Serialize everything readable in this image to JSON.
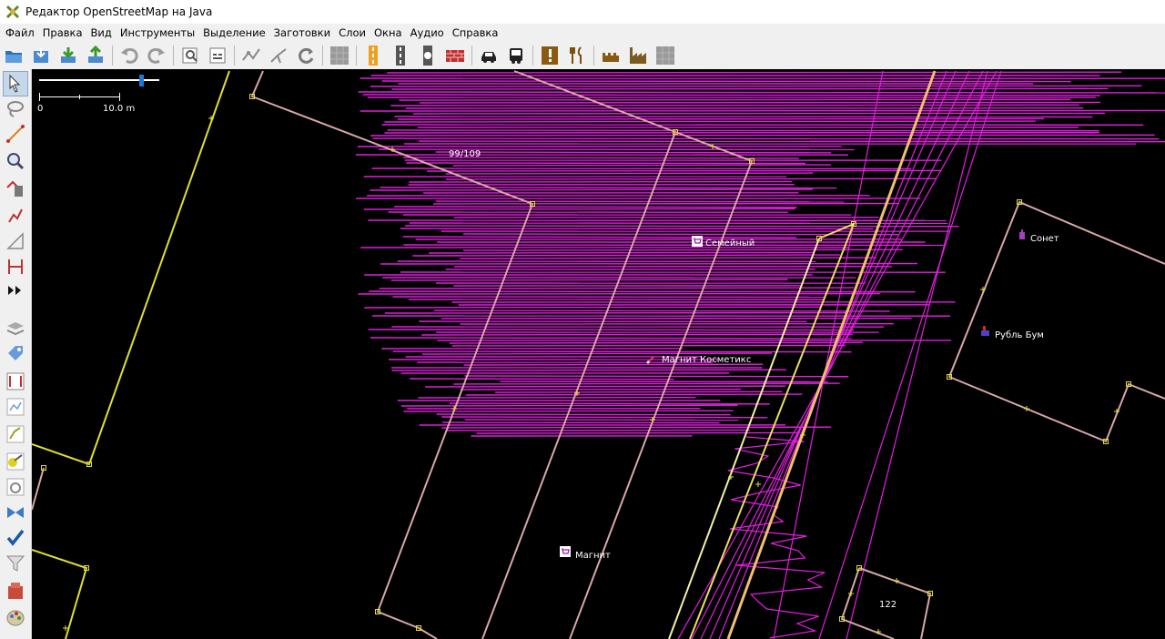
{
  "window": {
    "title": "Редактор OpenStreetMap на Java"
  },
  "menu": [
    "Файл",
    "Правка",
    "Вид",
    "Инструменты",
    "Выделение",
    "Заготовки",
    "Слои",
    "Окна",
    "Аудио",
    "Справка"
  ],
  "toolbar": {
    "groups": [
      [
        "open-file-icon",
        "download-icon",
        "download-green-icon",
        "upload-icon"
      ],
      [
        "undo-icon",
        "redo-icon"
      ],
      [
        "zoom-preferences-icon",
        "layer-props-icon"
      ],
      [
        "simplify-way-icon",
        "split-way-icon",
        "refresh-icon"
      ],
      [
        "preset-grey-icon"
      ],
      [
        "preset-road-yellow-icon",
        "preset-road-icon",
        "preset-traffic-light-icon",
        "preset-wall-icon"
      ],
      [
        "preset-car-icon",
        "preset-bus-icon"
      ],
      [
        "preset-warning-icon",
        "preset-restaurant-icon"
      ],
      [
        "preset-castle-icon",
        "preset-factory-icon",
        "preset-grey2-icon"
      ]
    ]
  },
  "sidebar": {
    "tools": [
      "select-tool-icon",
      "lasso-tool-icon",
      "draw-tool-icon",
      "zoom-tool-icon",
      "delete-tool-icon",
      "improve-way-tool-icon",
      "parallel-tool-icon",
      "extrude-tool-icon",
      "more-tools-icon",
      "layer-list-icon",
      "properties-icon",
      "relations-icon",
      "history-icon",
      "selection-list-icon",
      "tag-checker-icon",
      "changeset-icon",
      "conflict-icon",
      "validator-icon",
      "filter-icon",
      "toggle-dialog-icon",
      "map-paint-icon"
    ]
  },
  "map": {
    "scale": {
      "zero": "0",
      "distance": "10.0 m"
    },
    "labels": {
      "housenumber": "99/109",
      "semeyny": "Семейный",
      "sonet": "Сонет",
      "rubl_bum": "Рубль Бум",
      "magnit_kosmetik": "Магнит Косметикс",
      "magnit": "Магнит",
      "house122": "122"
    },
    "colors": {
      "gps": "#e21ee0",
      "building": "#d8a8a8",
      "road": "#f2f2a6",
      "road_main": "#f0c070",
      "highlight": "#e0e030",
      "node": "#e0e030"
    }
  }
}
